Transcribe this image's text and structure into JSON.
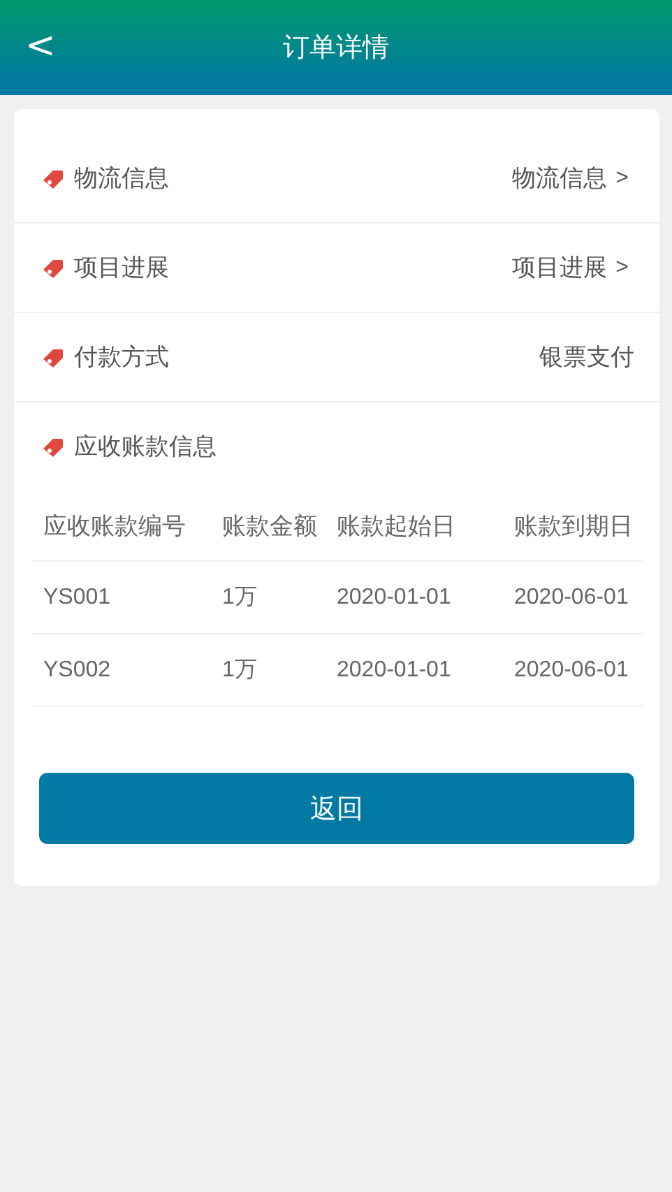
{
  "header": {
    "back": "<",
    "title": "订单详情"
  },
  "rows": [
    {
      "kind": "link",
      "label": "物流信息",
      "value": "物流信息",
      "chevron": ">"
    },
    {
      "kind": "link",
      "label": "项目进展",
      "value": "项目进展",
      "chevron": ">"
    },
    {
      "kind": "text",
      "label": "付款方式",
      "value": "银票支付"
    }
  ],
  "receivables": {
    "label": "应收账款信息",
    "columns": [
      "应收账款编号",
      "账款金额",
      "账款起始日",
      "账款到期日"
    ],
    "rows": [
      [
        "YS001",
        "1万",
        "2020-01-01",
        "2020-06-01"
      ],
      [
        "YS002",
        "1万",
        "2020-01-01",
        "2020-06-01"
      ]
    ]
  },
  "button": "返回"
}
